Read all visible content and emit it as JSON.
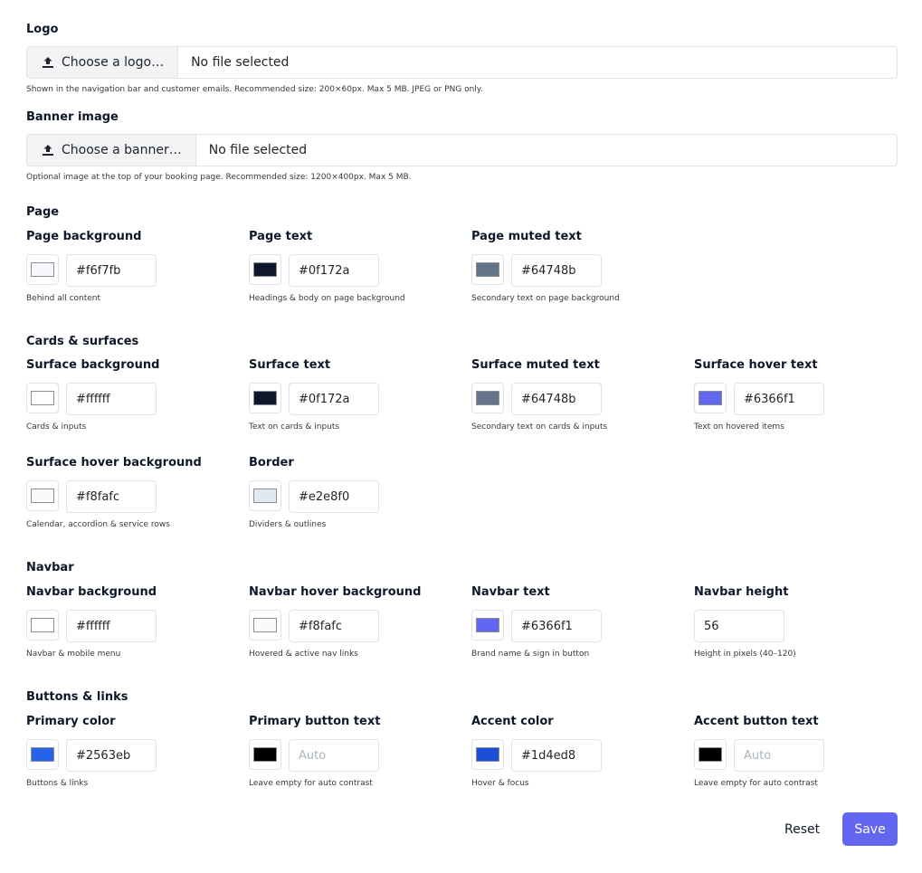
{
  "logo": {
    "label": "Logo",
    "button_label": "Choose a logo…",
    "status": "No file selected",
    "help": "Shown in the navigation bar and customer emails. Recommended size: 200×60px. Max 5 MB. JPEG or PNG only."
  },
  "banner": {
    "label": "Banner image",
    "button_label": "Choose a banner…",
    "status": "No file selected",
    "help": "Optional image at the top of your booking page. Recommended size: 1200×400px. Max 5 MB."
  },
  "sections": {
    "page": {
      "title": "Page",
      "fields": [
        {
          "label": "Page background",
          "value": "#f6f7fb",
          "swatch": "#f6f7fb",
          "help": "Behind all content"
        },
        {
          "label": "Page text",
          "value": "#0f172a",
          "swatch": "#0f172a",
          "help": "Headings & body on page background"
        },
        {
          "label": "Page muted text",
          "value": "#64748b",
          "swatch": "#64748b",
          "help": "Secondary text on page background"
        }
      ]
    },
    "cards": {
      "title": "Cards & surfaces",
      "fields": [
        {
          "label": "Surface background",
          "value": "#ffffff",
          "swatch": "#ffffff",
          "help": "Cards & inputs"
        },
        {
          "label": "Surface text",
          "value": "#0f172a",
          "swatch": "#0f172a",
          "help": "Text on cards & inputs"
        },
        {
          "label": "Surface muted text",
          "value": "#64748b",
          "swatch": "#64748b",
          "help": "Secondary text on cards & inputs"
        },
        {
          "label": "Surface hover text",
          "value": "#6366f1",
          "swatch": "#6366f1",
          "help": "Text on hovered items"
        },
        {
          "label": "Surface hover background",
          "value": "#f8fafc",
          "swatch": "#f8fafc",
          "help": "Calendar, accordion & service rows"
        },
        {
          "label": "Border",
          "value": "#e2e8f0",
          "swatch": "#e2e8f0",
          "help": "Dividers & outlines"
        }
      ]
    },
    "navbar": {
      "title": "Navbar",
      "fields": [
        {
          "label": "Navbar background",
          "value": "#ffffff",
          "swatch": "#ffffff",
          "help": "Navbar & mobile menu"
        },
        {
          "label": "Navbar hover background",
          "value": "#f8fafc",
          "swatch": "#f8fafc",
          "help": "Hovered & active nav links"
        },
        {
          "label": "Navbar text",
          "value": "#6366f1",
          "swatch": "#6366f1",
          "help": "Brand name & sign in button"
        }
      ],
      "height": {
        "label": "Navbar height",
        "value": "56",
        "help": "Height in pixels (40–120)"
      }
    },
    "buttons": {
      "title": "Buttons & links",
      "fields": [
        {
          "label": "Primary color",
          "value": "#2563eb",
          "swatch": "#2563eb",
          "help": "Buttons & links"
        },
        {
          "label": "Primary button text",
          "value": "",
          "placeholder": "Auto",
          "swatch": "#000000",
          "help": "Leave empty for auto contrast"
        },
        {
          "label": "Accent color",
          "value": "#1d4ed8",
          "swatch": "#1d4ed8",
          "help": "Hover & focus"
        },
        {
          "label": "Accent button text",
          "value": "",
          "placeholder": "Auto",
          "swatch": "#000000",
          "help": "Leave empty for auto contrast"
        }
      ]
    }
  },
  "actions": {
    "reset_label": "Reset",
    "save_label": "Save",
    "save_color": "#6366f1"
  },
  "icons": {
    "upload": "upload-icon"
  }
}
